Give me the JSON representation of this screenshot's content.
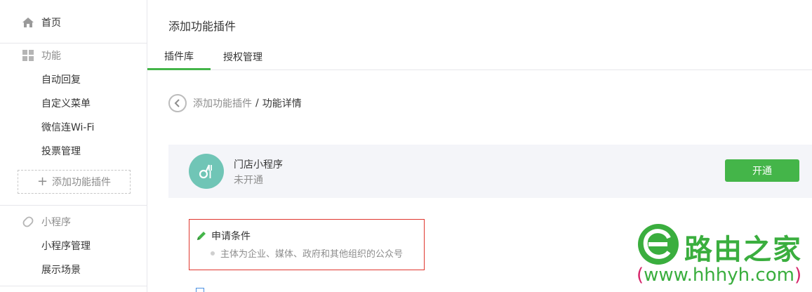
{
  "sidebar": {
    "home_label": "首页",
    "func_section_label": "功能",
    "func_items": [
      {
        "label": "自动回复"
      },
      {
        "label": "自定义菜单"
      },
      {
        "label": "微信连Wi-Fi"
      },
      {
        "label": "投票管理"
      }
    ],
    "add_plugin_label": "添加功能插件",
    "mini_section_label": "小程序",
    "mini_items": [
      {
        "label": "小程序管理"
      },
      {
        "label": "展示场景"
      }
    ]
  },
  "main": {
    "page_title": "添加功能插件",
    "tabs": [
      {
        "label": "插件库",
        "active": true
      },
      {
        "label": "授权管理",
        "active": false
      }
    ],
    "breadcrumb": {
      "parent": "添加功能插件",
      "separator": "/",
      "current": "功能详情"
    },
    "plugin": {
      "name": "门店小程序",
      "status": "未开通",
      "open_label": "开通"
    },
    "conditions": {
      "title": "申请条件",
      "items": [
        "主体为企业、媒体、政府和其他组织的公众号"
      ]
    }
  },
  "watermark": {
    "title": "路由之家",
    "url": "www.hhhyh.com",
    "paren_open": "(",
    "paren_close": ")"
  },
  "colors": {
    "accent": "#44b549",
    "border_highlight": "#e0362e",
    "plugin_logo_bg": "#70c5b6",
    "card_bg": "#f4f5f9"
  },
  "icons": {
    "home": "home-icon",
    "func": "grid-icon",
    "mini": "link-icon",
    "back": "chevron-left-icon",
    "plugin": "fork-spoon-icon",
    "condition": "pen-icon"
  }
}
